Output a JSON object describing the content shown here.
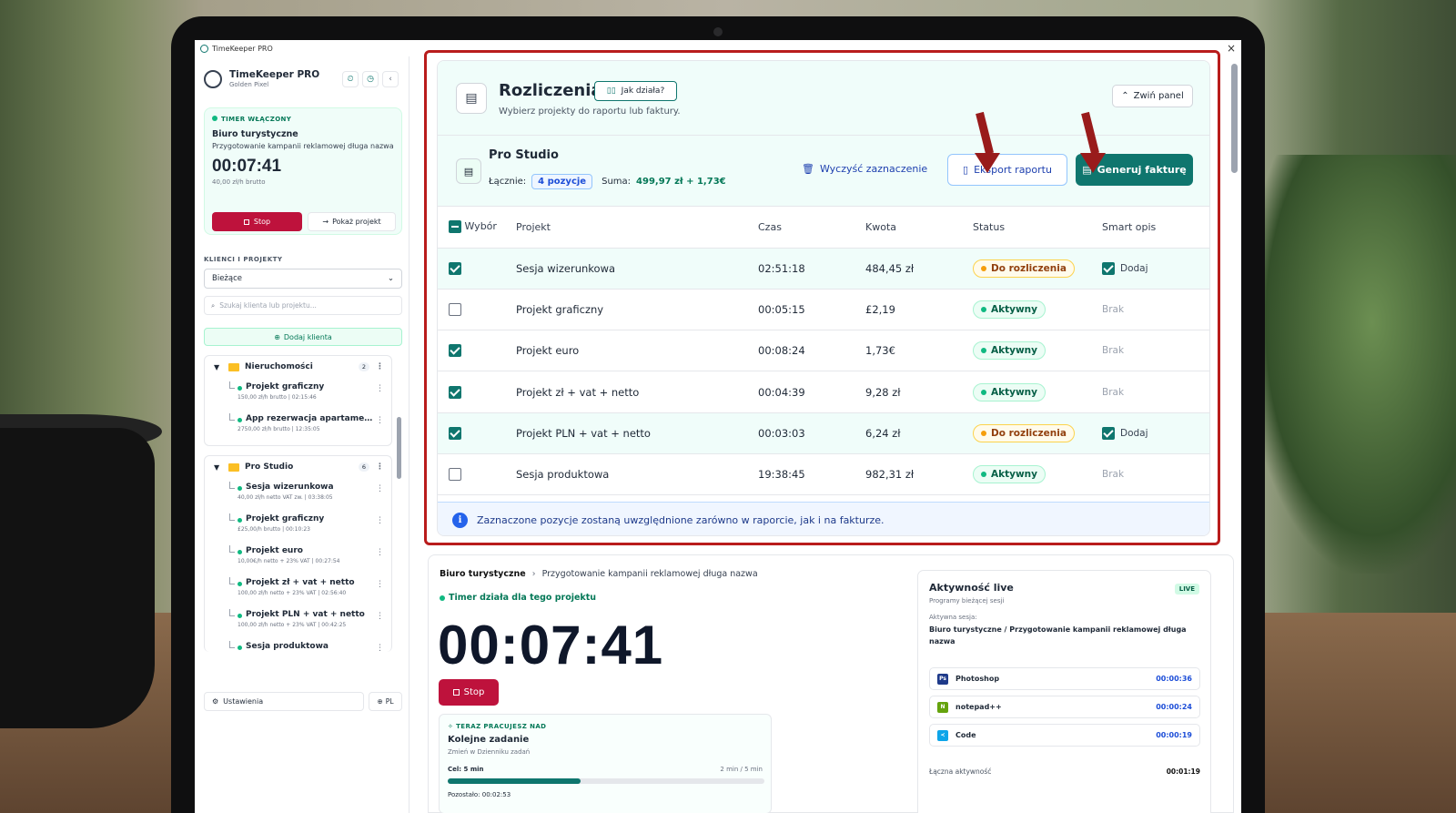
{
  "window": {
    "title": "TimeKeeper PRO"
  },
  "sidebar": {
    "brand_title": "TimeKeeper PRO",
    "brand_sub": "Golden Pixel",
    "timer": {
      "status": "TIMER WŁĄCZONY",
      "client": "Biuro turystyczne",
      "task": "Przygotowanie kampanii reklamowej długa nazwa",
      "time": "00:07:41",
      "rate": "40,00 zł/h brutto",
      "stop_label": "Stop",
      "show_label": "Pokaż projekt"
    },
    "section_label": "KLIENCI I PROJEKTY",
    "filter_value": "Bieżące",
    "search_placeholder": "Szukaj klienta lub projektu...",
    "add_client_label": "Dodaj klienta",
    "groups": [
      {
        "name": "Nieruchomości",
        "count": "2",
        "projects": [
          {
            "name": "Projekt graficzny",
            "meta": "150,00 zł/h brutto | 02:15:46"
          },
          {
            "name": "App rezerwacja apartame...",
            "meta": "2750,00 zł/h brutto | 12:35:05"
          }
        ]
      },
      {
        "name": "Pro Studio",
        "count": "6",
        "projects": [
          {
            "name": "Sesja wizerunkowa",
            "meta": "40,00 zł/h netto VAT zw. | 03:38:05"
          },
          {
            "name": "Projekt graficzny",
            "meta": "£25,00/h brutto | 00:10:23"
          },
          {
            "name": "Projekt euro",
            "meta": "10,00€/h netto + 23% VAT | 00:27:54"
          },
          {
            "name": "Projekt zł + vat + netto",
            "meta": "100,00 zł/h netto + 23% VAT | 02:56:40"
          },
          {
            "name": "Projekt PLN + vat + netto",
            "meta": "100,00 zł/h netto + 23% VAT | 00:42:25"
          },
          {
            "name": "Sesja produktowa",
            "meta": ""
          }
        ]
      }
    ],
    "settings_label": "Ustawienia",
    "lang_label": "PL"
  },
  "billing": {
    "title": "Rozliczenia",
    "help_label": "Jak działa?",
    "subtitle": "Wybierz projekty do raportu lub faktury.",
    "collapse_label": "Zwiń panel",
    "client_name": "Pro Studio",
    "total_label": "Łącznie:",
    "items_count": "4 pozycje",
    "sum_label": "Suma:",
    "sum_value": "499,97 zł + 1,73€",
    "clear_label": "Wyczyść zaznaczenie",
    "export_label": "Eksport raportu",
    "invoice_label": "Generuj fakturę",
    "columns": [
      "Wybór",
      "Projekt",
      "Czas",
      "Kwota",
      "Status",
      "Smart opis"
    ],
    "rows": [
      {
        "selected": true,
        "project": "Sesja wizerunkowa",
        "time": "02:51:18",
        "amount": "484,45 zł",
        "status": "Do rozliczenia",
        "status_kind": "warn",
        "smart": "Dodaj",
        "smart_checked": true
      },
      {
        "selected": false,
        "project": "Projekt graficzny",
        "time": "00:05:15",
        "amount": "£2,19",
        "status": "Aktywny",
        "status_kind": "ok",
        "smart": "Brak",
        "smart_checked": false
      },
      {
        "selected": true,
        "project": "Projekt euro",
        "time": "00:08:24",
        "amount": "1,73€",
        "status": "Aktywny",
        "status_kind": "ok",
        "smart": "Brak",
        "smart_checked": false
      },
      {
        "selected": true,
        "project": "Projekt zł + vat + netto",
        "time": "00:04:39",
        "amount": "9,28 zł",
        "status": "Aktywny",
        "status_kind": "ok",
        "smart": "Brak",
        "smart_checked": false
      },
      {
        "selected": true,
        "project": "Projekt PLN + vat + netto",
        "time": "00:03:03",
        "amount": "6,24 zł",
        "status": "Do rozliczenia",
        "status_kind": "warn",
        "smart": "Dodaj",
        "smart_checked": true
      },
      {
        "selected": false,
        "project": "Sesja produktowa",
        "time": "19:38:45",
        "amount": "982,31 zł",
        "status": "Aktywny",
        "status_kind": "ok",
        "smart": "Brak",
        "smart_checked": false
      }
    ],
    "info_text": "Zaznaczone pozycje zostaną uwzględnione zarówno w raporcie, jak i na fakturze."
  },
  "session": {
    "client": "Biuro turystyczne",
    "task": "Przygotowanie kampanii reklamowej długa nazwa",
    "running_label": "Timer działa dla tego projektu",
    "time": "00:07:41",
    "stop_label": "Stop",
    "focus": {
      "label": "TERAZ PRACUJESZ NAD",
      "title": "Kolejne zadanie",
      "sub": "Zmień w Dzienniku zadań",
      "goal": "Cel: 5 min",
      "goal_progress": "2 min / 5 min",
      "progress": 0.42,
      "remaining": "Pozostało: 00:02:53"
    }
  },
  "live": {
    "title": "Aktywność live",
    "badge": "LIVE",
    "subtitle": "Programy bieżącej sesji",
    "active_label": "Aktywna sesja:",
    "active_session": "Biuro turystyczne / Przygotowanie kampanii reklamowej długa nazwa",
    "apps": [
      {
        "name": "Photoshop",
        "time": "00:00:36",
        "icon": "photoshop-icon",
        "color": "#1e3a8a",
        "glyph": "Ps"
      },
      {
        "name": "notepad++",
        "time": "00:00:24",
        "icon": "notepad-icon",
        "color": "#65a30d",
        "glyph": "N"
      },
      {
        "name": "Code",
        "time": "00:00:19",
        "icon": "vscode-icon",
        "color": "#0ea5e9",
        "glyph": "≺"
      }
    ],
    "total_label": "Łączna aktywność",
    "total_time": "00:01:19"
  },
  "colors": {
    "accent": "#0f766e",
    "danger": "#be123c",
    "annotation": "#b91c1c"
  }
}
